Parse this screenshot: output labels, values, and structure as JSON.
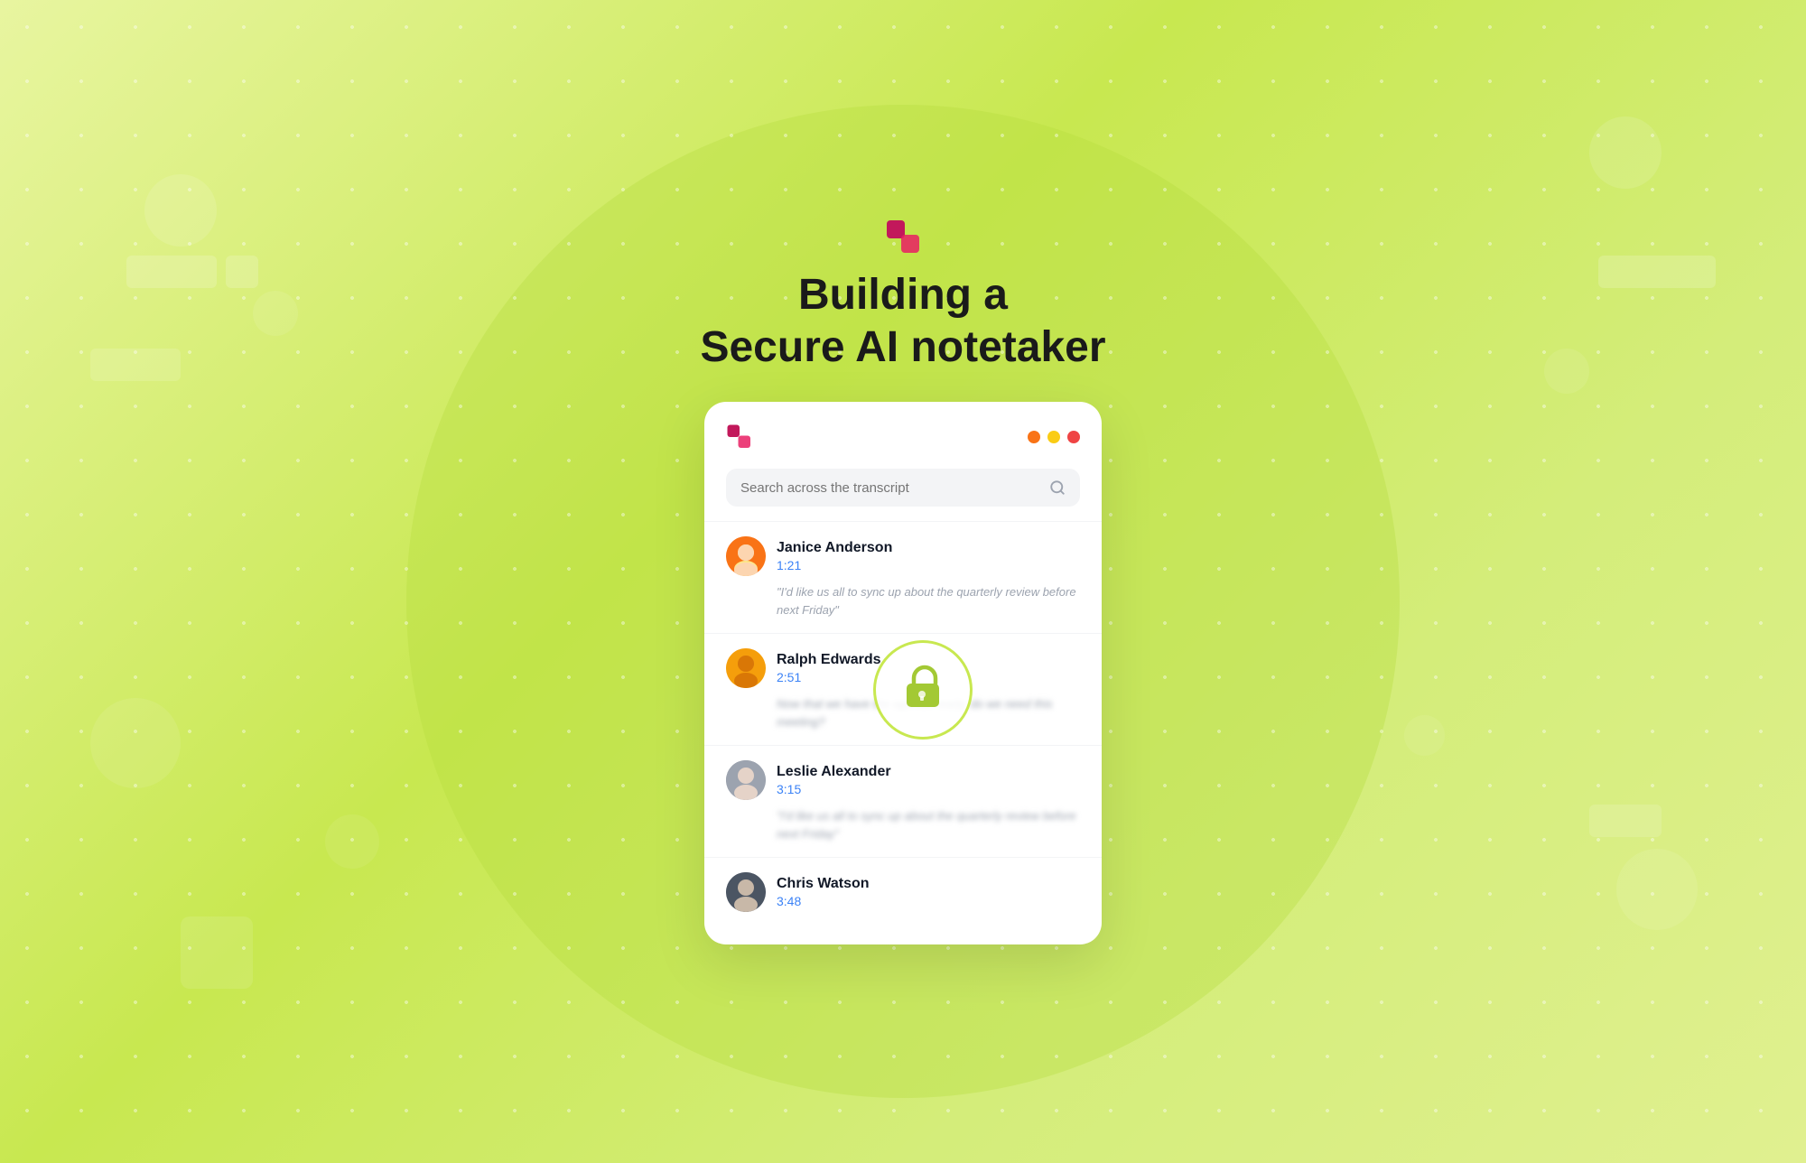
{
  "background": {
    "color": "#d4ed7a"
  },
  "page_title": {
    "line1": "Building a",
    "line2": "Secure AI notetaker"
  },
  "logo": {
    "alt": "Taskade-style logo mark"
  },
  "card": {
    "traffic_lights": [
      {
        "color": "#f97316",
        "label": "close"
      },
      {
        "color": "#facc15",
        "label": "minimize"
      },
      {
        "color": "#ef4444",
        "label": "maximize"
      }
    ],
    "search": {
      "placeholder": "Search across the transcript",
      "value": ""
    },
    "entries": [
      {
        "id": "janice",
        "name": "Janice Anderson",
        "time": "1:21",
        "text": "\"I'd like us all to sync up about the quarterly review before next Friday\""
      },
      {
        "id": "ralph",
        "name": "Ralph Edwards",
        "time": "2:51",
        "text": "Now that we have the agenda ready, do we need this meeting?"
      },
      {
        "id": "leslie",
        "name": "Leslie Alexander",
        "time": "3:15",
        "text": "\"I'd like us all to sync up about the quarterly review before next Friday\""
      },
      {
        "id": "chris",
        "name": "Chris Watson",
        "time": "3:48",
        "text": ""
      }
    ]
  }
}
